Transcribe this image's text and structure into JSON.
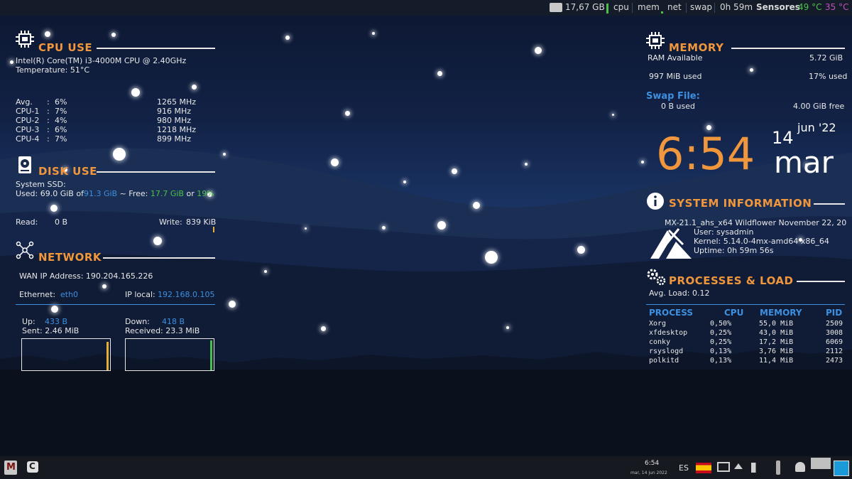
{
  "topbar": {
    "disk": "17,67 GB",
    "cpu_label": "cpu",
    "mem_label": "mem",
    "net_label": "net",
    "swap_label": "swap",
    "uptime": "0h 59m",
    "sensors_label": "Sensores",
    "temp1": "49 °C",
    "temp2": "35 °C"
  },
  "cpu": {
    "title": "CPU USE",
    "model": "Intel(R) Core(TM) i3-4000M CPU @ 2.40GHz",
    "temperature": "Temperature: 51°C",
    "rows": [
      {
        "label": "Avg.",
        "sep": ":",
        "pct": "6%",
        "freq": "1265 MHz"
      },
      {
        "label": "CPU-1",
        "sep": ":",
        "pct": "7%",
        "freq": "916 MHz"
      },
      {
        "label": "CPU-2",
        "sep": ":",
        "pct": "4%",
        "freq": "980 MHz"
      },
      {
        "label": "CPU-3",
        "sep": ":",
        "pct": "6%",
        "freq": "1218 MHz"
      },
      {
        "label": "CPU-4",
        "sep": ":",
        "pct": "7%",
        "freq": "899 MHz"
      }
    ]
  },
  "disk": {
    "title": "DISK USE",
    "name": "System SSD:",
    "used_label": "Used: 69.0 GiB of",
    "total": "91.3 GiB",
    "free_label": " ~ Free: ",
    "free": "17.7 GiB",
    "or": " or ",
    "pct": "19%",
    "read_label": "Read:",
    "read_value": "0 B",
    "write_label": "Write:",
    "write_value": "839 KiB"
  },
  "network": {
    "title": "NETWORK",
    "wan": "WAN IP Address: 190.204.165.226",
    "ethernet_label": "Ethernet:",
    "ethernet_value": "eth0",
    "iplocal_label": "IP local:",
    "iplocal_value": "192.168.0.105",
    "up_label": "Up:",
    "up_value": "433 B",
    "sent": "Sent: 2.46 MiB",
    "down_label": "Down:",
    "down_value": "418 B",
    "received": "Received: 23.3 MiB"
  },
  "memory": {
    "title": "MEMORY",
    "ram_label": "RAM Available",
    "ram_total": "5.72 GiB",
    "used": "997 MiB used",
    "used_pct": "17% used",
    "swap_title": "Swap File:",
    "swap_used": "0 B used",
    "swap_free": "4.00 GiB free"
  },
  "clock": {
    "time": "6:54",
    "day": "14",
    "monthyear": "jun '22",
    "weekday": "mar"
  },
  "sysinfo": {
    "title": "SYSTEM INFORMATION",
    "distro": "MX-21.1_ahs_x64 Wildflower November 22, 20",
    "user": "User: sysadmin",
    "kernel": "Kernel: 5.14.0-4mx-amd64 x86_64",
    "uptime": "Uptime: 0h 59m 56s"
  },
  "processes": {
    "title": "PROCESSES & LOAD",
    "avg_load": "Avg. Load: 0.12",
    "headers": {
      "process": "PROCESS",
      "cpu": "CPU",
      "memory": "MEMORY",
      "pid": "PID"
    },
    "rows": [
      {
        "name": "Xorg",
        "cpu": "0,50%",
        "mem": "55,0 MiB",
        "pid": "2509"
      },
      {
        "name": "xfdesktop",
        "cpu": "0,25%",
        "mem": "43,0 MiB",
        "pid": "3008"
      },
      {
        "name": "conky",
        "cpu": "0,25%",
        "mem": "17,2 MiB",
        "pid": "6069"
      },
      {
        "name": "rsyslogd",
        "cpu": "0,13%",
        "mem": "3,76 MiB",
        "pid": "2112"
      },
      {
        "name": "polkitd",
        "cpu": "0,13%",
        "mem": "11,4 MiB",
        "pid": "2473"
      }
    ]
  },
  "taskbar": {
    "time": "6:54",
    "date": "mar, 14 jun 2022",
    "lang": "ES"
  },
  "colors": {
    "accent_orange": "#f0963c",
    "accent_blue": "#3d8fe0",
    "accent_green": "#4cc04c",
    "temp_pink": "#c050c0"
  },
  "icons": [
    "disk-icon",
    "chip-icon",
    "hdd-icon",
    "network-icon",
    "info-icon",
    "gear-icon",
    "mx-logo-icon",
    "flag-es-icon",
    "monitor-icon",
    "eject-icon",
    "volume-icon",
    "usb-icon",
    "bell-icon",
    "workspace-icon",
    "app-menu-icon",
    "app-launcher-icon"
  ]
}
